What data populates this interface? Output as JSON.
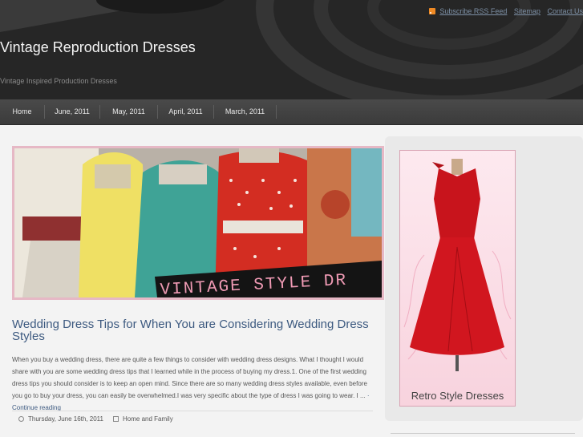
{
  "header": {
    "top_links": [
      "Subscribe RSS Feed",
      "Sitemap",
      "Contact Us"
    ],
    "site_title": "Vintage Reproduction Dresses",
    "tagline": "Vintage Inspired Production Dresses"
  },
  "nav": {
    "items": [
      "Home",
      "June, 2011",
      "May, 2011",
      "April, 2011",
      "March, 2011"
    ]
  },
  "featured": {
    "banner_text": "VINTAGE STYLE DR"
  },
  "post": {
    "title": "Wedding Dress Tips for When You are Considering Wedding Dress Styles",
    "excerpt": "When you buy a wedding dress, there are quite a few things to consider with wedding dress designs. What I thought I would share with you are some wedding dress tips that I learned while in the process of buying my dress.1. One of the first wedding dress tips you should consider is to keep an open mind. Since there are so many wedding dress styles available, even before you go to buy your dress, you can easily be overwhelmed.I was very specific about the type of dress I was going to wear. I ...",
    "continue_link": "· Continue reading",
    "date": "Thursday, June 16th, 2011",
    "category": "Home and Family"
  },
  "sidebar": {
    "ad_label": "Retro Style Dresses"
  },
  "icons": {
    "rss": "rss-icon",
    "date": "clock-icon",
    "category": "folder-icon"
  }
}
